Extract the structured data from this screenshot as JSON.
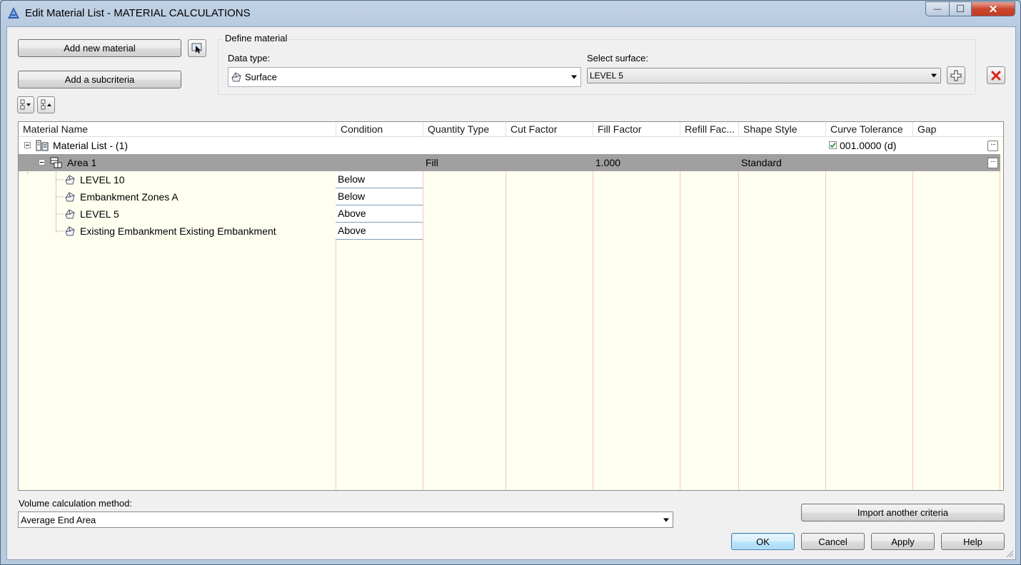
{
  "window": {
    "title": "Edit Material List - MATERIAL CALCULATIONS",
    "minimize_symbol": "—",
    "maximize_symbol": "☐",
    "close_symbol": "✕"
  },
  "toolbar": {
    "add_new_material": "Add new material",
    "add_subcriteria": "Add a subcriteria"
  },
  "define_material": {
    "group_title": "Define material",
    "data_type_label": "Data type:",
    "data_type_value": "Surface",
    "select_surface_label": "Select surface:",
    "select_surface_value": "LEVEL 5"
  },
  "grid": {
    "columns": [
      "Material Name",
      "Condition",
      "Quantity Type",
      "Cut Factor",
      "Fill Factor",
      "Refill Fac...",
      "Shape Style",
      "Curve Tolerance",
      "Gap"
    ],
    "root": {
      "name": "Material List - (1)",
      "curve_tolerance": "001.0000 (d)"
    },
    "area": {
      "name": "Area 1",
      "quantity_type": "Fill",
      "fill_factor": "1.000",
      "shape_style": "Standard"
    },
    "criteria": [
      {
        "name": "LEVEL 10",
        "condition": "Below"
      },
      {
        "name": "Embankment Zones A",
        "condition": "Below"
      },
      {
        "name": "LEVEL 5",
        "condition": "Above"
      },
      {
        "name": "Existing Embankment Existing Embankment",
        "condition": "Above"
      }
    ]
  },
  "volume": {
    "label": "Volume calculation method:",
    "value": "Average End Area"
  },
  "buttons": {
    "import": "Import another criteria",
    "ok": "OK",
    "cancel": "Cancel",
    "apply": "Apply",
    "help": "Help"
  },
  "colors": {
    "selected_row": "#a0a0a0",
    "grid_background": "#fffff0",
    "column_divider": "#f2c6c6",
    "delete_red": "#d9261c"
  }
}
